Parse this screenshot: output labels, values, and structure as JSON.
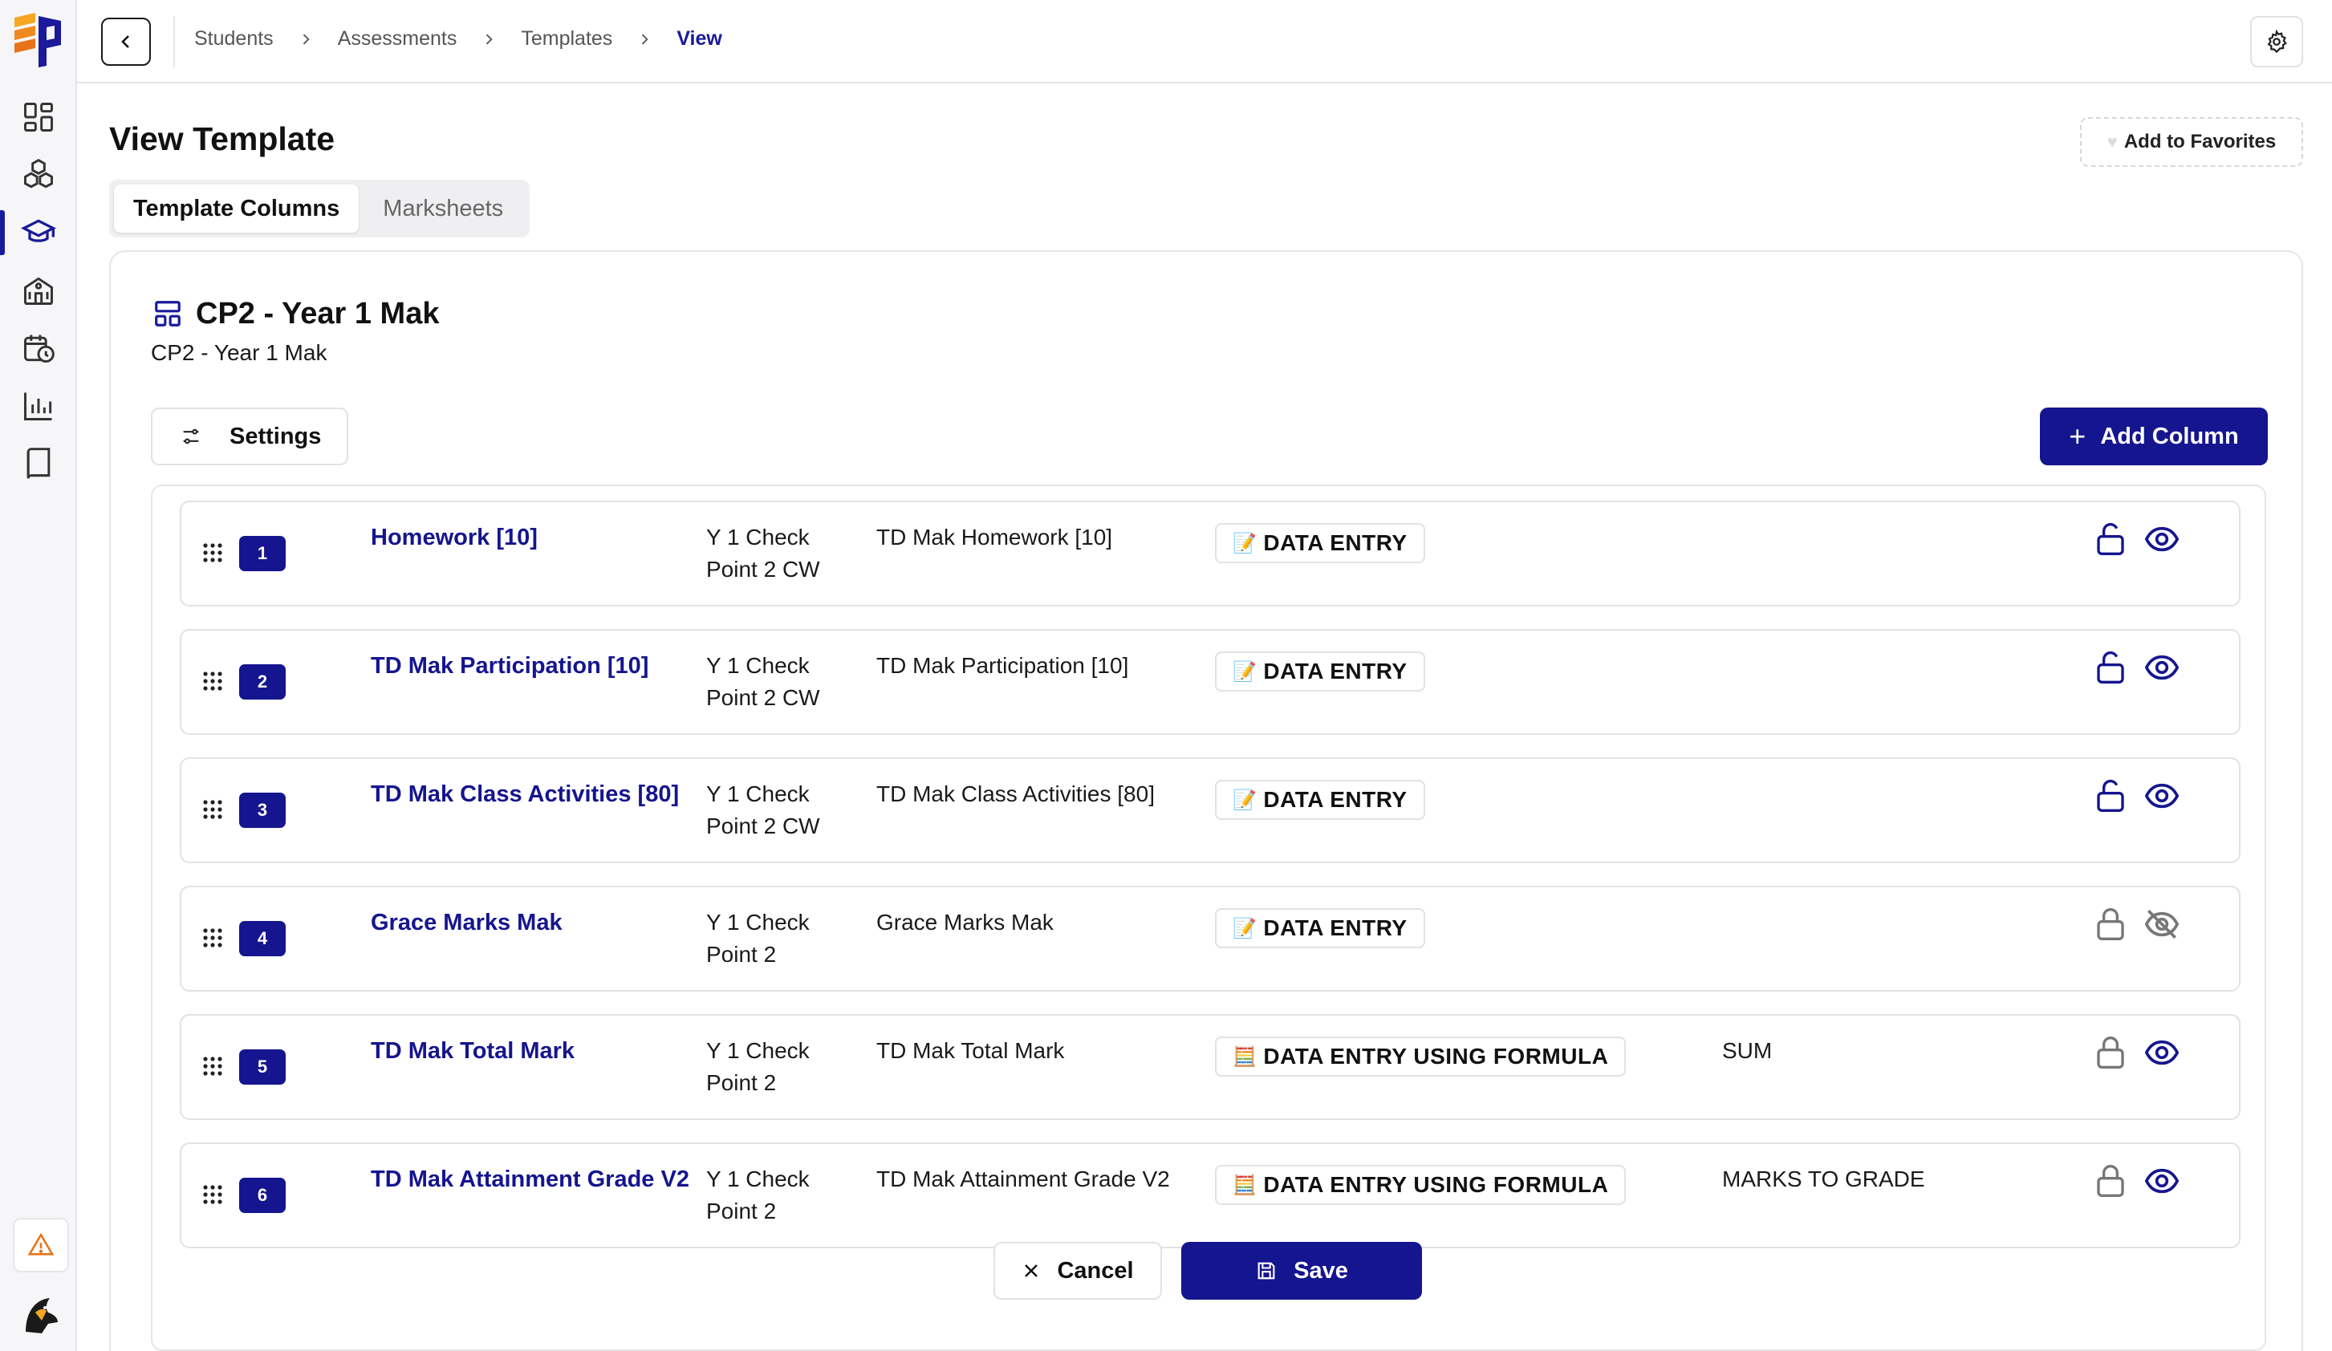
{
  "breadcrumb": [
    "Students",
    "Assessments",
    "Templates",
    "View"
  ],
  "page_title": "View Template",
  "favorites_label": "Add to Favorites",
  "tabs": [
    {
      "label": "Template Columns",
      "active": true
    },
    {
      "label": "Marksheets",
      "active": false
    }
  ],
  "template": {
    "title": "CP2 - Year 1 Mak",
    "subtitle": "CP2 - Year 1 Mak"
  },
  "settings_label": "Settings",
  "add_column_label": "Add Column",
  "columns": [
    {
      "num": "1",
      "name": "Homework [10]",
      "group": "Y 1 Check Point 2 CW",
      "label": "TD Mak Homework [10]",
      "type_icon": "📝",
      "type": "DATA ENTRY",
      "formula": "",
      "locked": false,
      "visible": true
    },
    {
      "num": "2",
      "name": "TD Mak Participation [10]",
      "group": "Y 1 Check Point 2 CW",
      "label": "TD Mak Participation [10]",
      "type_icon": "📝",
      "type": "DATA ENTRY",
      "formula": "",
      "locked": false,
      "visible": true
    },
    {
      "num": "3",
      "name": "TD Mak Class Activities [80]",
      "group": "Y 1 Check Point 2 CW",
      "label": "TD Mak Class Activities [80]",
      "type_icon": "📝",
      "type": "DATA ENTRY",
      "formula": "",
      "locked": false,
      "visible": true
    },
    {
      "num": "4",
      "name": "Grace Marks Mak",
      "group": "Y 1 Check Point 2",
      "label": "Grace Marks Mak",
      "type_icon": "📝",
      "type": "DATA ENTRY",
      "formula": "",
      "locked": true,
      "visible": false
    },
    {
      "num": "5",
      "name": "TD Mak Total Mark",
      "group": "Y 1 Check Point 2",
      "label": "TD Mak Total Mark",
      "type_icon": "🧮",
      "type": "DATA ENTRY USING FORMULA",
      "formula": "SUM",
      "locked": true,
      "visible": true
    },
    {
      "num": "6",
      "name": "TD Mak Attainment Grade V2",
      "group": "Y 1 Check Point 2",
      "label": "TD Mak Attainment Grade V2",
      "type_icon": "🧮",
      "type": "DATA ENTRY USING FORMULA",
      "formula": "MARKS TO GRADE",
      "locked": true,
      "visible": true
    }
  ],
  "cancel_label": "Cancel",
  "save_label": "Save",
  "colors": {
    "accent": "#15158f",
    "logo_orange": "#f5a623",
    "logo_blue": "#1a1a9a"
  }
}
